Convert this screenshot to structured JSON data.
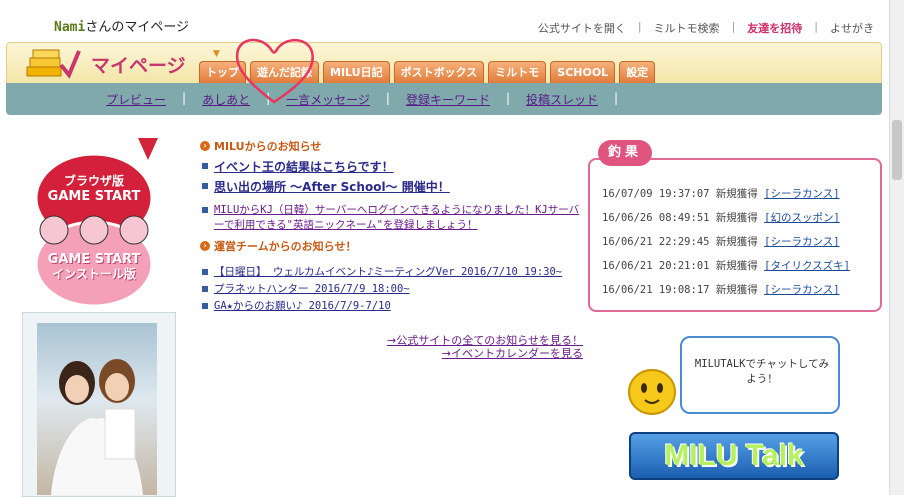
{
  "user": {
    "name": "Nami",
    "title_suffix": "さんのマイページ"
  },
  "top_links": [
    "公式サイトを開く",
    "ミルトモ検索",
    "友達を招待",
    "よせがき"
  ],
  "header": {
    "heading": "マイページ"
  },
  "tabs": [
    "トップ",
    "遊んだ記録",
    "MILU日記",
    "ポストボックス",
    "ミルトモ",
    "SCHOOL",
    "設定"
  ],
  "subnav": [
    "プレビュー",
    "あしあと",
    "一言メッセージ",
    "登録キーワード",
    "投稿スレッド"
  ],
  "badge": {
    "top_line1": "ブラウザ版",
    "top_line2": "GAME START",
    "bottom_line1": "GAME START",
    "bottom_line2": "インストール版"
  },
  "news": {
    "milu_heading": "MILUからのお知らせ",
    "milu_items": [
      "イベント王の結果はこちらです！",
      "思い出の場所 〜After School〜 開催中！",
      "MILUからKJ（日韓）サーバーへログインできるようになりました！KJサーバーで利用できる\"英語ニックネーム\"を登録しましょう！"
    ],
    "team_heading": "運営チームからのお知らせ！",
    "team_items": [
      "【日曜日】 ウェルカムイベント♪ミーティングVer 2016/7/10 19:30~",
      "プラネットハンター 2016/7/9 18:00~",
      "GA★からのお願い♪ 2016/7/9-7/10"
    ],
    "more_all": "→公式サイトの全てのお知らせを見る！",
    "more_calendar": "→イベントカレンダーを見る"
  },
  "fishing": {
    "label": "釣果",
    "rows": [
      {
        "time": "16/07/09 19:37:07",
        "status": "新規獲得",
        "fish": "[シーラカンス]"
      },
      {
        "time": "16/06/26 08:49:51",
        "status": "新規獲得",
        "fish": "[幻のスッポン]"
      },
      {
        "time": "16/06/21 22:29:45",
        "status": "新規獲得",
        "fish": "[シーラカンス]"
      },
      {
        "time": "16/06/21 20:21:01",
        "status": "新規獲得",
        "fish": "[タイリクスズキ]"
      },
      {
        "time": "16/06/21 19:08:17",
        "status": "新規獲得",
        "fish": "[シーラカンス]"
      }
    ]
  },
  "chat": {
    "bubble_text": "MILUTALKでチャットしてみよう！",
    "button_label": "MILU Talk"
  },
  "colors": {
    "accent_pink": "#d0306c",
    "subnav_bg": "#7fa9aa",
    "tab_orange": "#e07c3c"
  }
}
